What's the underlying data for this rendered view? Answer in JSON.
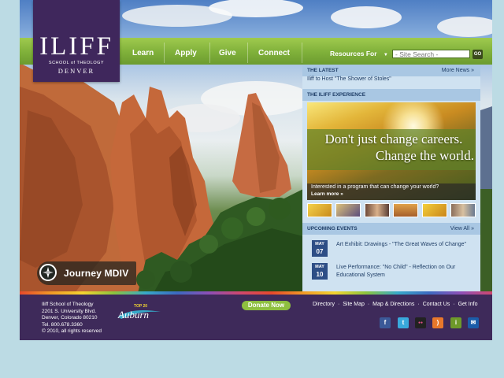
{
  "logo": {
    "name": "ILIFF",
    "subtitle": "SCHOOL of THEOLOGY",
    "city": "DENVER"
  },
  "nav": {
    "items": [
      "Learn",
      "Apply",
      "Give",
      "Connect"
    ],
    "resources_label": "Resources For",
    "search_placeholder": "- Site Search -",
    "go_label": "GO"
  },
  "latest": {
    "heading": "THE LATEST",
    "more_label": "More News »",
    "headline": "Iliff to Host \"The Shower of Stoles\""
  },
  "experience": {
    "heading": "THE ILIFF EXPERIENCE",
    "promo_line1": "Don't just change careers.",
    "promo_line2": "Change the world.",
    "caption": "Interested in a program that can change your world?",
    "learn_more": "Learn more »"
  },
  "thumbnails": [
    "gold-leaves",
    "gold-scroll",
    "people",
    "landscape",
    "gold-leaves-2",
    "group"
  ],
  "events": {
    "heading": "UPCOMING EVENTS",
    "view_all": "View All »",
    "items": [
      {
        "month": "MAY",
        "day": "07",
        "title": "Art Exhibit: Drawings - \"The Great Waves of Change\""
      },
      {
        "month": "MAY",
        "day": "10",
        "title": "Live Performance: \"No Child\" - Reflection on Our Educational System"
      }
    ]
  },
  "badge": {
    "label": "Journey MDIV",
    "icon": "compass-icon"
  },
  "footer": {
    "address": [
      "Iliff School of Theology",
      "2201 S. University Blvd.",
      "Denver, Colorado 80210",
      "Tel. 800.678.3360",
      "© 2010, all rights reserved"
    ],
    "auburn_top": "TOP 20",
    "auburn_name": "Auburn",
    "donate_label": "Donate Now",
    "links": [
      "Directory",
      "Site Map",
      "Map & Directions",
      "Contact Us",
      "Get Info"
    ],
    "social": [
      {
        "name": "facebook-icon",
        "glyph": "f",
        "color": "#3b5998"
      },
      {
        "name": "twitter-icon",
        "glyph": "t",
        "color": "#39a9dc"
      },
      {
        "name": "flickr-icon",
        "glyph": "●●",
        "color": "#222222"
      },
      {
        "name": "rss-icon",
        "glyph": ")",
        "color": "#e8782b"
      },
      {
        "name": "info-icon",
        "glyph": "i",
        "color": "#6e9a2a"
      },
      {
        "name": "email-icon",
        "glyph": "✉",
        "color": "#1b5ca8"
      }
    ]
  },
  "colors": {
    "purple": "#3e2a5a",
    "green": "#7fb03a",
    "panel": "#cfe2f1",
    "navy": "#2d4e86"
  }
}
